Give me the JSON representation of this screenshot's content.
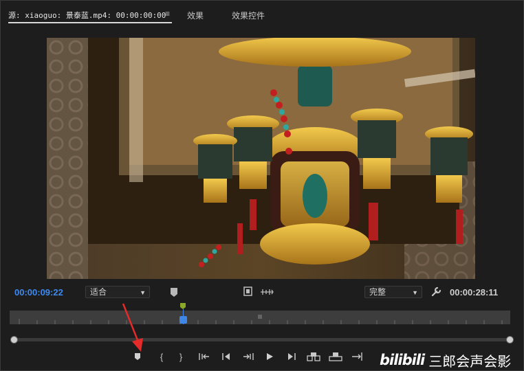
{
  "tabs": {
    "source": "源: xiaoguo: 景泰蓝.mp4: 00:00:00:00",
    "menu_icon": "≡",
    "effects": "效果",
    "effect_controls": "效果控件"
  },
  "monitor": {
    "current_timecode": "00:00:09:22",
    "duration_timecode": "00:00:28:11",
    "fit_select": "适合",
    "quality_select": "完整"
  },
  "icons": {
    "marker": "marker-icon",
    "film": "film-icon",
    "export_frame": "export-frame-icon",
    "wrench": "wrench-icon",
    "dropdown": "chevron-down-icon"
  },
  "transport": {
    "add_marker": "add-marker-icon",
    "mark_in": "{",
    "mark_out": "}",
    "go_to_in": "go-to-in-icon",
    "step_back": "step-back-icon",
    "step_forward_clip": "step-forward-icon",
    "play": "play-icon",
    "step_forward": "step-forward-frame-icon",
    "insert": "insert-icon",
    "overwrite": "overwrite-icon",
    "export": "export-frame-icon"
  },
  "watermark": {
    "logo": "bilibili",
    "text": "三郎会声会影"
  },
  "colors": {
    "accent_timecode": "#3d8bf0",
    "playhead": "#3f86e6",
    "annotation_arrow": "#e52a2a"
  }
}
